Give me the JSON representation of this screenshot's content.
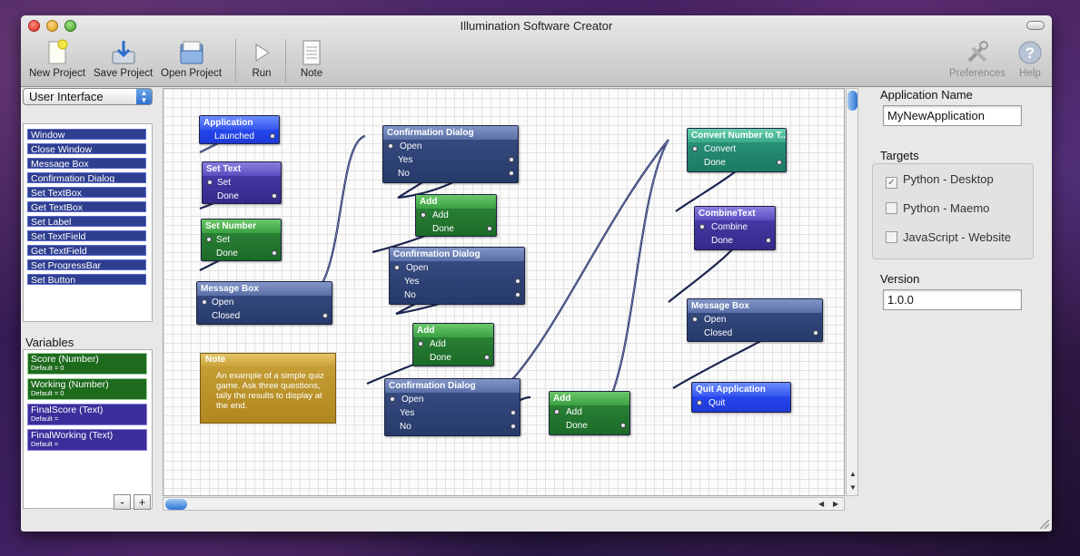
{
  "window": {
    "title": "Illumination Software Creator"
  },
  "toolbar": {
    "new_project": "New Project",
    "save_project": "Save Project",
    "open_project": "Open Project",
    "run": "Run",
    "note": "Note",
    "preferences": "Preferences",
    "help": "Help"
  },
  "left": {
    "category_selected": "User Interface",
    "components": [
      "Window",
      "Close Window",
      "Message Box",
      "Confirmation Dialog",
      "Set TextBox",
      "Get TextBox",
      "Set Label",
      "Set TextField",
      "Get TextField",
      "Set ProgressBar",
      "Set Button"
    ],
    "variables_title": "Variables",
    "variables": [
      {
        "name": "Score (Number)",
        "default": "Default = 0"
      },
      {
        "name": "Working (Number)",
        "default": "Default = 0"
      },
      {
        "name": "FinalScore (Text)",
        "default": "Default ="
      },
      {
        "name": "FinalWorking (Text)",
        "default": "Default ="
      }
    ],
    "remove_label": "-",
    "add_label": "+"
  },
  "canvas": {
    "nodes": {
      "application": {
        "title": "Application",
        "r1": "Launched"
      },
      "settext": {
        "title": "Set Text",
        "r1": "Set",
        "r2": "Done"
      },
      "setnumber": {
        "title": "Set Number",
        "r1": "Set",
        "r2": "Done"
      },
      "msgbox1": {
        "title": "Message Box",
        "r1": "Open",
        "r2": "Closed"
      },
      "confirm1": {
        "title": "Confirmation Dialog",
        "r1": "Open",
        "r2": "Yes",
        "r3": "No"
      },
      "add1": {
        "title": "Add",
        "r1": "Add",
        "r2": "Done"
      },
      "confirm2": {
        "title": "Confirmation Dialog",
        "r1": "Open",
        "r2": "Yes",
        "r3": "No"
      },
      "add2": {
        "title": "Add",
        "r1": "Add",
        "r2": "Done"
      },
      "confirm3": {
        "title": "Confirmation Dialog",
        "r1": "Open",
        "r2": "Yes",
        "r3": "No"
      },
      "add3": {
        "title": "Add",
        "r1": "Add",
        "r2": "Done"
      },
      "convert": {
        "title": "Convert Number to T...",
        "r1": "Convert",
        "r2": "Done"
      },
      "combine": {
        "title": "CombineText",
        "r1": "Combine",
        "r2": "Done"
      },
      "msgbox2": {
        "title": "Message Box",
        "r1": "Open",
        "r2": "Closed"
      },
      "quit": {
        "title": "Quit Application",
        "r1": "Quit"
      }
    },
    "note": {
      "title": "Note",
      "body": "An example of a simple quiz game.  Ask three questions, tally the results to display at the end."
    }
  },
  "right": {
    "app_name_label": "Application Name",
    "app_name_value": "MyNewApplication",
    "targets_label": "Targets",
    "targets": [
      {
        "label": "Python - Desktop",
        "checked": true
      },
      {
        "label": "Python - Maemo",
        "checked": false
      },
      {
        "label": "JavaScript - Website",
        "checked": false
      }
    ],
    "version_label": "Version",
    "version_value": "1.0.0"
  }
}
